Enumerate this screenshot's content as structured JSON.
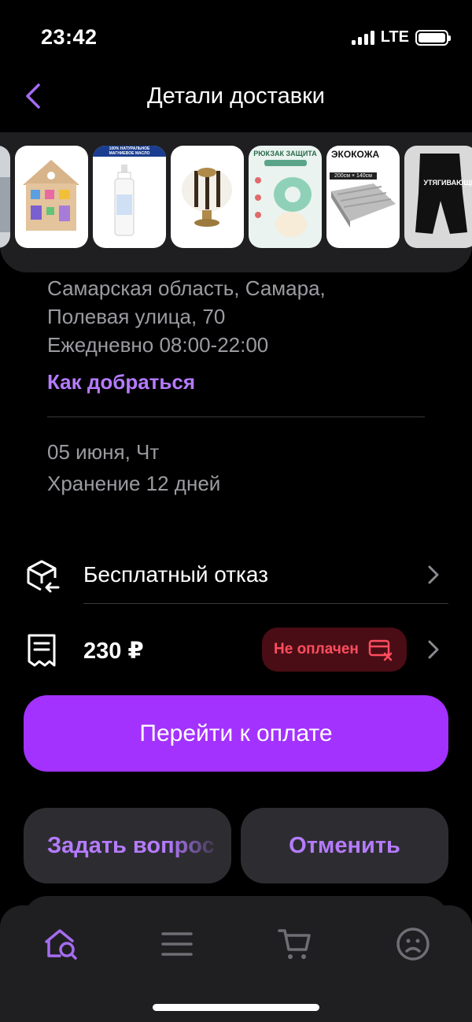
{
  "status_bar": {
    "time": "23:42",
    "network": "LTE"
  },
  "header": {
    "title": "Детали доставки",
    "back_icon": "chevron-left-icon"
  },
  "products": {
    "thumbnails": [
      {
        "name": "product-thumb-partial",
        "caption": ""
      },
      {
        "name": "product-thumb-busyboard-house",
        "caption": ""
      },
      {
        "name": "product-thumb-magnesium-oil",
        "caption": "100% НАТУРАЛЬНОЕ МАГНИЕВОЕ МАСЛО"
      },
      {
        "name": "product-thumb-knob",
        "caption": ""
      },
      {
        "name": "product-thumb-head-protector",
        "caption": "РЮКЗАК ЗАЩИТА"
      },
      {
        "name": "product-thumb-ecoleather",
        "caption": "ЭКОКОЖА",
        "sub": "200см × 140см"
      },
      {
        "name": "product-thumb-shorts",
        "caption": "УТЯГИВАЮЩИ"
      }
    ]
  },
  "pickup": {
    "address_line1": "Самарская область, Самара,",
    "address_line2": "Полевая улица, 70",
    "hours": "Ежедневно 08:00-22:00",
    "directions_link": "Как добраться",
    "date": "05 июня, Чт",
    "storage": "Хранение 12 дней"
  },
  "refusal": {
    "label": "Бесплатный отказ",
    "icon": "box-return-icon"
  },
  "payment": {
    "amount": "230 ₽",
    "icon": "receipt-icon",
    "status": "Не оплачен",
    "status_icon": "card-cross-icon"
  },
  "actions": {
    "pay": "Перейти к оплате",
    "ask": "Задать вопрос",
    "cancel": "Отменить"
  },
  "tabbar": [
    {
      "name": "tab-home",
      "icon": "home-search-icon",
      "active": true
    },
    {
      "name": "tab-catalog",
      "icon": "menu-icon",
      "active": false
    },
    {
      "name": "tab-cart",
      "icon": "cart-icon",
      "active": false
    },
    {
      "name": "tab-profile",
      "icon": "profile-icon",
      "active": false
    }
  ],
  "colors": {
    "accent": "#a332ff",
    "link": "#b57bff",
    "surface": "#1f1f21",
    "error_bg": "#4a0d15",
    "error_text": "#ff4d5e"
  }
}
